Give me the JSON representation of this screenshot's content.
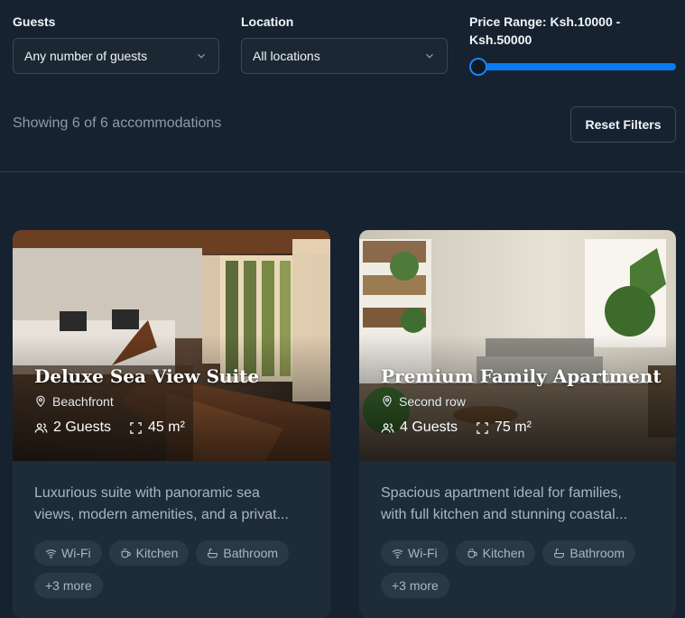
{
  "filters": {
    "guests_label": "Guests",
    "guests_value": "Any number of guests",
    "location_label": "Location",
    "location_value": "All locations",
    "price_label_line1": "Price Range: Ksh.10000 -",
    "price_label_line2": "Ksh.50000",
    "price_min": 10000,
    "price_max": 50000,
    "showing_text": "Showing 6 of 6 accommodations",
    "reset_label": "Reset Filters"
  },
  "cards": [
    {
      "title": "Deluxe Sea View Suite",
      "location": "Beachfront",
      "guests": "2 Guests",
      "size": "45 m²",
      "desc_line1": "Luxurious suite with panoramic sea",
      "desc_line2": "views, modern amenities, and a privat...",
      "amenities": [
        "Wi-Fi",
        "Kitchen",
        "Bathroom"
      ],
      "more": "+3 more"
    },
    {
      "title": "Premium Family Apartment",
      "location": "Second row",
      "guests": "4 Guests",
      "size": "75 m²",
      "desc_line1": "Spacious apartment ideal for families,",
      "desc_line2": "with full kitchen and stunning coastal...",
      "amenities": [
        "Wi-Fi",
        "Kitchen",
        "Bathroom"
      ],
      "more": "+3 more"
    }
  ],
  "colors": {
    "background": "#162230",
    "card": "#1e2b39",
    "accent": "#0a7bf0"
  }
}
